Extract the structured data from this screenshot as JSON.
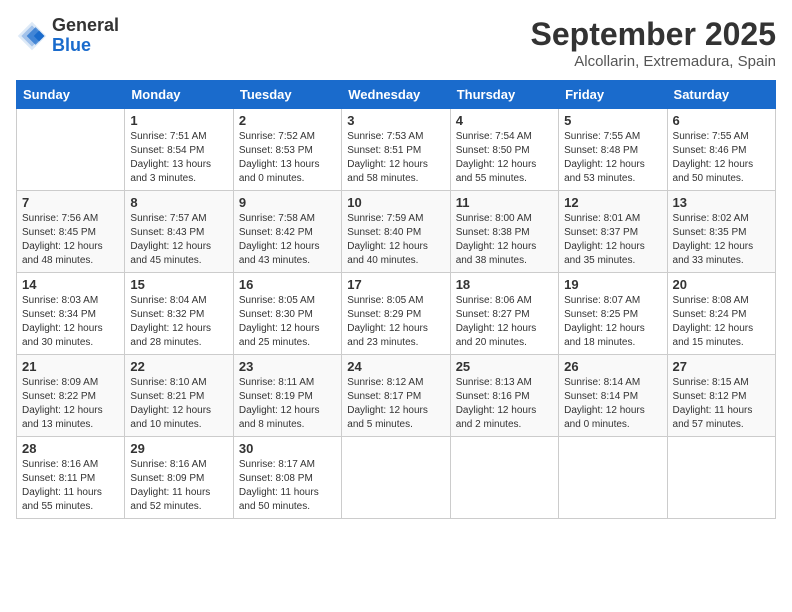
{
  "header": {
    "logo_general": "General",
    "logo_blue": "Blue",
    "month_title": "September 2025",
    "location": "Alcollarin, Extremadura, Spain"
  },
  "days_of_week": [
    "Sunday",
    "Monday",
    "Tuesday",
    "Wednesday",
    "Thursday",
    "Friday",
    "Saturday"
  ],
  "weeks": [
    [
      {
        "day": "",
        "info": ""
      },
      {
        "day": "1",
        "info": "Sunrise: 7:51 AM\nSunset: 8:54 PM\nDaylight: 13 hours\nand 3 minutes."
      },
      {
        "day": "2",
        "info": "Sunrise: 7:52 AM\nSunset: 8:53 PM\nDaylight: 13 hours\nand 0 minutes."
      },
      {
        "day": "3",
        "info": "Sunrise: 7:53 AM\nSunset: 8:51 PM\nDaylight: 12 hours\nand 58 minutes."
      },
      {
        "day": "4",
        "info": "Sunrise: 7:54 AM\nSunset: 8:50 PM\nDaylight: 12 hours\nand 55 minutes."
      },
      {
        "day": "5",
        "info": "Sunrise: 7:55 AM\nSunset: 8:48 PM\nDaylight: 12 hours\nand 53 minutes."
      },
      {
        "day": "6",
        "info": "Sunrise: 7:55 AM\nSunset: 8:46 PM\nDaylight: 12 hours\nand 50 minutes."
      }
    ],
    [
      {
        "day": "7",
        "info": "Sunrise: 7:56 AM\nSunset: 8:45 PM\nDaylight: 12 hours\nand 48 minutes."
      },
      {
        "day": "8",
        "info": "Sunrise: 7:57 AM\nSunset: 8:43 PM\nDaylight: 12 hours\nand 45 minutes."
      },
      {
        "day": "9",
        "info": "Sunrise: 7:58 AM\nSunset: 8:42 PM\nDaylight: 12 hours\nand 43 minutes."
      },
      {
        "day": "10",
        "info": "Sunrise: 7:59 AM\nSunset: 8:40 PM\nDaylight: 12 hours\nand 40 minutes."
      },
      {
        "day": "11",
        "info": "Sunrise: 8:00 AM\nSunset: 8:38 PM\nDaylight: 12 hours\nand 38 minutes."
      },
      {
        "day": "12",
        "info": "Sunrise: 8:01 AM\nSunset: 8:37 PM\nDaylight: 12 hours\nand 35 minutes."
      },
      {
        "day": "13",
        "info": "Sunrise: 8:02 AM\nSunset: 8:35 PM\nDaylight: 12 hours\nand 33 minutes."
      }
    ],
    [
      {
        "day": "14",
        "info": "Sunrise: 8:03 AM\nSunset: 8:34 PM\nDaylight: 12 hours\nand 30 minutes."
      },
      {
        "day": "15",
        "info": "Sunrise: 8:04 AM\nSunset: 8:32 PM\nDaylight: 12 hours\nand 28 minutes."
      },
      {
        "day": "16",
        "info": "Sunrise: 8:05 AM\nSunset: 8:30 PM\nDaylight: 12 hours\nand 25 minutes."
      },
      {
        "day": "17",
        "info": "Sunrise: 8:05 AM\nSunset: 8:29 PM\nDaylight: 12 hours\nand 23 minutes."
      },
      {
        "day": "18",
        "info": "Sunrise: 8:06 AM\nSunset: 8:27 PM\nDaylight: 12 hours\nand 20 minutes."
      },
      {
        "day": "19",
        "info": "Sunrise: 8:07 AM\nSunset: 8:25 PM\nDaylight: 12 hours\nand 18 minutes."
      },
      {
        "day": "20",
        "info": "Sunrise: 8:08 AM\nSunset: 8:24 PM\nDaylight: 12 hours\nand 15 minutes."
      }
    ],
    [
      {
        "day": "21",
        "info": "Sunrise: 8:09 AM\nSunset: 8:22 PM\nDaylight: 12 hours\nand 13 minutes."
      },
      {
        "day": "22",
        "info": "Sunrise: 8:10 AM\nSunset: 8:21 PM\nDaylight: 12 hours\nand 10 minutes."
      },
      {
        "day": "23",
        "info": "Sunrise: 8:11 AM\nSunset: 8:19 PM\nDaylight: 12 hours\nand 8 minutes."
      },
      {
        "day": "24",
        "info": "Sunrise: 8:12 AM\nSunset: 8:17 PM\nDaylight: 12 hours\nand 5 minutes."
      },
      {
        "day": "25",
        "info": "Sunrise: 8:13 AM\nSunset: 8:16 PM\nDaylight: 12 hours\nand 2 minutes."
      },
      {
        "day": "26",
        "info": "Sunrise: 8:14 AM\nSunset: 8:14 PM\nDaylight: 12 hours\nand 0 minutes."
      },
      {
        "day": "27",
        "info": "Sunrise: 8:15 AM\nSunset: 8:12 PM\nDaylight: 11 hours\nand 57 minutes."
      }
    ],
    [
      {
        "day": "28",
        "info": "Sunrise: 8:16 AM\nSunset: 8:11 PM\nDaylight: 11 hours\nand 55 minutes."
      },
      {
        "day": "29",
        "info": "Sunrise: 8:16 AM\nSunset: 8:09 PM\nDaylight: 11 hours\nand 52 minutes."
      },
      {
        "day": "30",
        "info": "Sunrise: 8:17 AM\nSunset: 8:08 PM\nDaylight: 11 hours\nand 50 minutes."
      },
      {
        "day": "",
        "info": ""
      },
      {
        "day": "",
        "info": ""
      },
      {
        "day": "",
        "info": ""
      },
      {
        "day": "",
        "info": ""
      }
    ]
  ]
}
